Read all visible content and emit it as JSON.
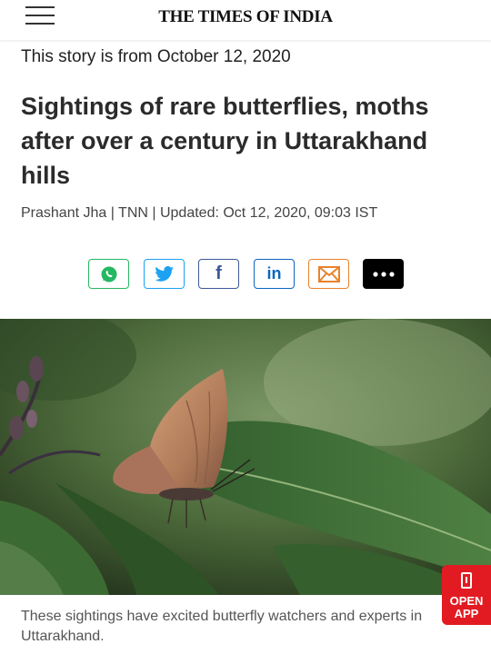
{
  "header": {
    "menu_icon": "hamburger-menu-icon",
    "logo": "THE TIMES OF INDIA"
  },
  "article": {
    "story_date": "This story is from October 12, 2020",
    "headline": "Sightings of rare butterflies, moths after over a century in Uttarakhand hills",
    "byline": "Prashant Jha | TNN | Updated: Oct 12, 2020, 09:03 IST"
  },
  "share": {
    "buttons": [
      {
        "icon": "whatsapp-icon",
        "color": "#25b862"
      },
      {
        "icon": "twitter-icon",
        "color": "#1da1f2"
      },
      {
        "icon": "facebook-icon",
        "color": "#3b5998"
      },
      {
        "icon": "linkedin-icon",
        "color": "#0a66c2"
      },
      {
        "icon": "email-icon",
        "color": "#e8822c"
      },
      {
        "icon": "more-icon",
        "color": "#000000"
      }
    ],
    "facebook_glyph": "f",
    "linkedin_glyph": "in"
  },
  "photo": {
    "caption": "These sightings have excited butterfly watchers and experts in Uttarakhand."
  },
  "open_app": {
    "line1": "OPEN",
    "line2": "APP",
    "color": "#e21b22"
  }
}
